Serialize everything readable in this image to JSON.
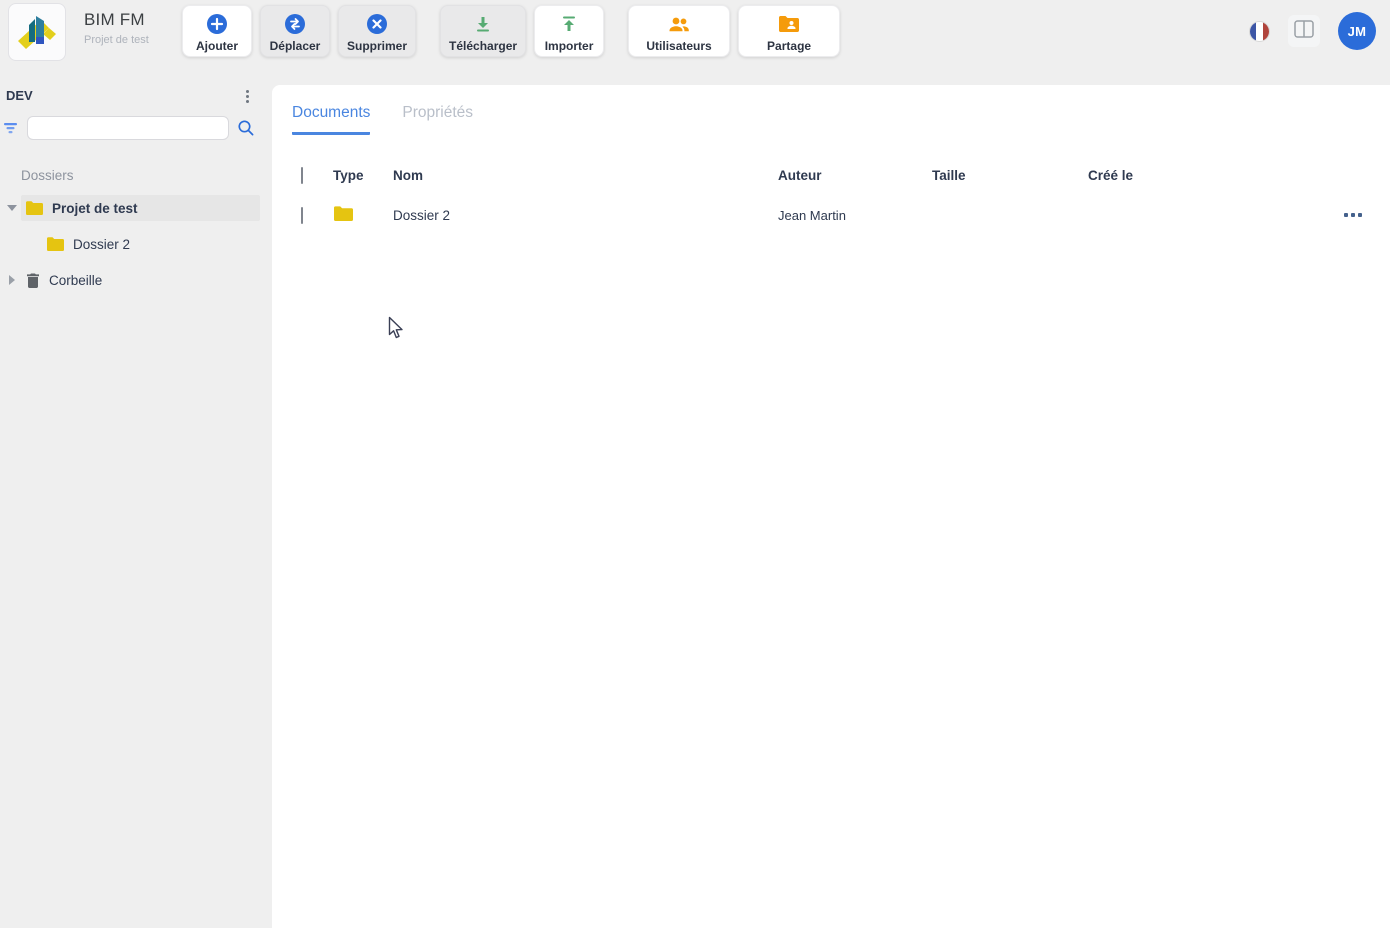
{
  "app": {
    "title": "BIM FM",
    "subtitle": "Projet de test"
  },
  "topbar": {
    "buttons": [
      {
        "label": "Ajouter",
        "icon": "plus-circle-icon",
        "enabled": true
      },
      {
        "label": "Déplacer",
        "icon": "move-arrows-icon",
        "enabled": false
      },
      {
        "label": "Supprimer",
        "icon": "x-circle-icon",
        "enabled": false
      },
      {
        "label": "Télécharger",
        "icon": "download-icon",
        "enabled": false
      },
      {
        "label": "Importer",
        "icon": "upload-icon",
        "enabled": true
      },
      {
        "label": "Utilisateurs",
        "icon": "people-icon",
        "enabled": true
      },
      {
        "label": "Partage",
        "icon": "folder-shared-icon",
        "enabled": true
      }
    ],
    "language": "french-flag",
    "avatar_initials": "JM"
  },
  "sidebar": {
    "env_label": "DEV",
    "search": {
      "value": "",
      "placeholder": ""
    },
    "section_label": "Dossiers",
    "tree": [
      {
        "label": "Projet de test",
        "icon": "folder",
        "level": 0,
        "expanded": true,
        "selected": true
      },
      {
        "label": "Dossier 2",
        "icon": "folder",
        "level": 1,
        "expanded": false,
        "selected": false
      },
      {
        "label": "Corbeille",
        "icon": "trash",
        "level": 0,
        "expanded": false,
        "selected": false
      }
    ]
  },
  "main": {
    "tabs": [
      {
        "label": "Documents",
        "active": true
      },
      {
        "label": "Propriétés",
        "active": false
      }
    ],
    "table": {
      "columns": [
        "Type",
        "Nom",
        "Auteur",
        "Taille",
        "Créé le"
      ],
      "rows": [
        {
          "type": "folder",
          "nom": "Dossier 2",
          "auteur": "Jean Martin",
          "taille": "",
          "cree_le": ""
        }
      ]
    }
  },
  "colors": {
    "primary_blue": "#2b6cd9",
    "tab_blue": "#4a86e0",
    "green": "#57ab73",
    "orange": "#f59b0b",
    "folder_yellow": "#e5c411",
    "page_bg": "#efefef",
    "panel_white": "#ffffff"
  }
}
